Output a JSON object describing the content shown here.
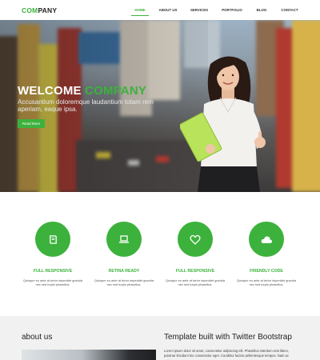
{
  "nav": {
    "logo_part1": "COM",
    "logo_part2": "PANY",
    "items": [
      {
        "label": "HOME",
        "active": true
      },
      {
        "label": "ABOUT US",
        "active": false
      },
      {
        "label": "SERVICES",
        "active": false
      },
      {
        "label": "PORTFOLIO",
        "active": false
      },
      {
        "label": "BLOG",
        "active": false
      },
      {
        "label": "CONTACT",
        "active": false
      }
    ]
  },
  "hero": {
    "title_part1": "WELCOME",
    "title_part2": "COMPANY",
    "subtitle": "Accusantium doloremque laudantium totam rem aperiam, eaque ipsa.",
    "button_label": "Read More"
  },
  "features": [
    {
      "icon": "book-icon",
      "title": "FULL RESPONSIVE",
      "text": "Quisque eu ante at tortor imperdiet gravida nec sed turpis phasellus."
    },
    {
      "icon": "laptop-icon",
      "title": "RETINA READY",
      "text": "Quisque eu ante at tortor imperdiet gravida nec sed turpis phasellus."
    },
    {
      "icon": "heart-icon",
      "title": "FULL RESPONSIVE",
      "text": "Quisque eu ante at tortor imperdiet gravida nec sed turpis phasellus."
    },
    {
      "icon": "cloud-icon",
      "title": "FRIENDLY CODE",
      "text": "Quisque eu ante at tortor imperdiet gravida nec sed turpis phasellus."
    }
  ],
  "about": {
    "title": "about us",
    "right_title": "Template built with Twitter Bootstrap",
    "right_text": "Lorem ipsum dolor sit amet, consectetur adipiscing elit. Phasellus interdum erat libero, pulvinar tincidunt leo consectetur eget. Curabitur lacinia pellentesque tempus. Nam ac pulvinar..."
  },
  "colors": {
    "accent": "#3cb23c"
  }
}
